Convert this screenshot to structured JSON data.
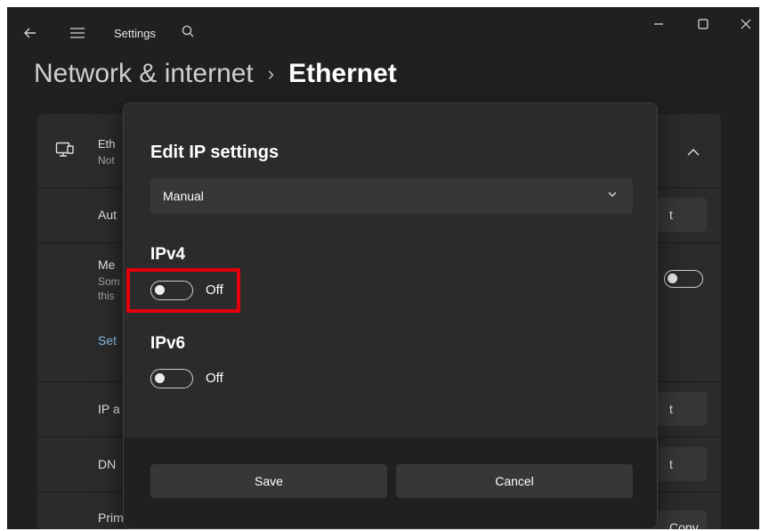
{
  "window": {
    "app_title": "Settings"
  },
  "breadcrumb": {
    "parent": "Network & internet",
    "separator": "›",
    "current": "Ethernet"
  },
  "background_card": {
    "ethernet_title_partial": "Eth",
    "ethernet_status_partial": "Not",
    "row_auth_partial": "Aut",
    "row_metered_partial": "Me",
    "row_metered_sub1_partial": "Som",
    "row_metered_sub2_partial": "this",
    "link_set_partial": "Set",
    "row_ip_partial": "IP a",
    "row_dns_partial": "DN",
    "row_primary_partial": "Prim",
    "side_button_partial": "t",
    "copy_button": "Copy"
  },
  "dialog": {
    "title": "Edit IP settings",
    "mode_select": {
      "selected": "Manual"
    },
    "ipv4": {
      "heading": "IPv4",
      "toggle_state": "Off"
    },
    "ipv6": {
      "heading": "IPv6",
      "toggle_state": "Off"
    },
    "buttons": {
      "save": "Save",
      "cancel": "Cancel"
    }
  },
  "colors": {
    "window_bg": "#202020",
    "card_bg": "#2b2b2b",
    "control_bg": "#373737",
    "highlight": "#e3000b",
    "link": "#8ec4ef"
  }
}
